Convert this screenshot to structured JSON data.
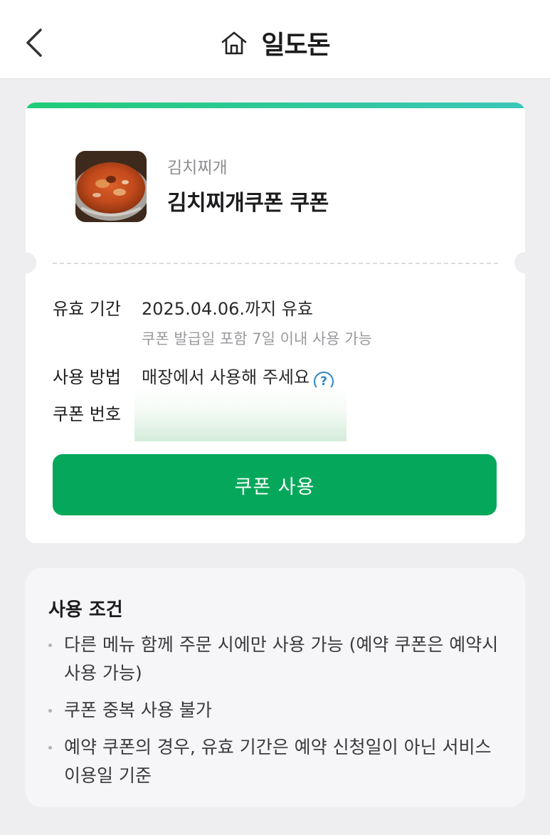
{
  "header": {
    "title": "일도돈",
    "back_icon": "chevron-left-icon",
    "home_icon": "home-icon"
  },
  "coupon": {
    "category": "김치찌개",
    "name": "김치찌개쿠폰 쿠폰",
    "image": "kimchi-stew-photo",
    "validity_label": "유효 기간",
    "validity_value": "2025.04.06.까지 유효",
    "validity_note": "쿠폰 발급일 포함 7일 이내 사용 가능",
    "method_label": "사용 방법",
    "method_value": "매장에서 사용해 주세요",
    "help_icon": "question-circle-icon",
    "help_glyph": "?",
    "number_label": "쿠폰 번호",
    "use_button": "쿠폰 사용"
  },
  "terms": {
    "title": "사용 조건",
    "items": [
      "다른 메뉴 함께 주문 시에만 사용 가능 (예약 쿠폰은 예약시 사용 가능)",
      "쿠폰 중복 사용 불가",
      "예약 쿠폰의 경우, 유효 기간은 예약 신청일이 아닌 서비스 이용일 기준"
    ]
  },
  "colors": {
    "accent_green": "#05a85a",
    "gradient_start": "#1fcb78",
    "gradient_end": "#3bc7b8",
    "help_blue": "#2f86c6"
  }
}
